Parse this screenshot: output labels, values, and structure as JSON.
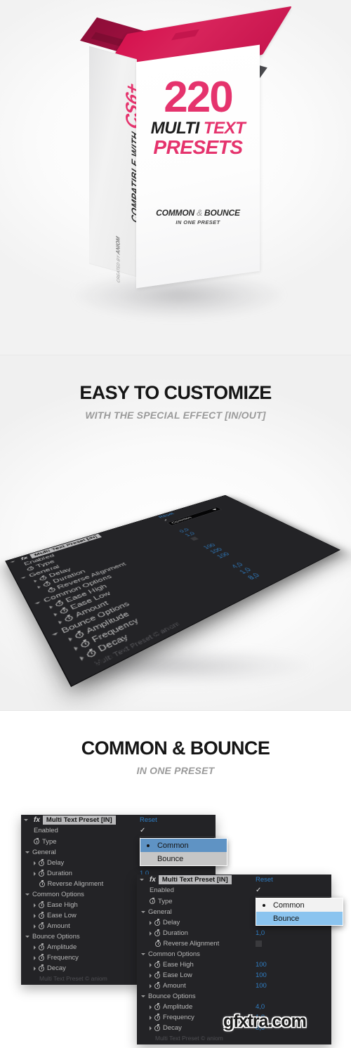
{
  "hero": {
    "spine_prefix": "COMPATIBLE WITH",
    "spine_version": "CS6+",
    "credit_prefix": "CREATED BY",
    "credit_name": "ANIOM",
    "count": "220",
    "multi": "MULTI",
    "text": "TEXT",
    "presets": "PRESETS",
    "common": "COMMON",
    "amp": "&",
    "bounce": "BOUNCE",
    "in_one_preset": "IN ONE PRESET"
  },
  "section_easy": {
    "heading": "EASY TO CUSTOMIZE",
    "subheading": "WITH THE SPECIAL EFFECT [IN/OUT]"
  },
  "section_common_bounce": {
    "heading": "COMMON & BOUNCE",
    "subheading": "IN ONE PRESET"
  },
  "effect_panel": {
    "title": "Multi Text Preset [IN]",
    "fx_label": "fx",
    "reset_label": "Reset",
    "enabled_label": "Enabled",
    "enabled_checked": "✓",
    "type_label": "Type",
    "type_value": "Common",
    "dropdown_options": [
      "Common",
      "Bounce"
    ],
    "groups": [
      {
        "label": "General",
        "rows": [
          {
            "label": "Delay",
            "value": "0,0",
            "twirl": true
          },
          {
            "label": "Duration",
            "value": "1,0",
            "twirl": true
          },
          {
            "label": "Reverse Alignment",
            "value": "",
            "twirl": false,
            "swatch": true
          }
        ]
      },
      {
        "label": "Common Options",
        "rows": [
          {
            "label": "Ease High",
            "value": "100",
            "twirl": true
          },
          {
            "label": "Ease Low",
            "value": "100",
            "twirl": true
          },
          {
            "label": "Amount",
            "value": "100",
            "twirl": true
          }
        ]
      },
      {
        "label": "Bounce Options",
        "rows": [
          {
            "label": "Amplitude",
            "value": "4,0",
            "twirl": true
          },
          {
            "label": "Frequency",
            "value": "1,0",
            "twirl": true
          },
          {
            "label": "Decay",
            "value": "8,0",
            "twirl": true
          }
        ]
      }
    ],
    "footer": "Multi Text Preset © aniom"
  },
  "watermark": "gfxtra.com",
  "colors": {
    "accent_pink": "#e5336d",
    "lid_crimson": "#d6134f",
    "panel_bg": "#232326",
    "value_blue": "#2f7ec4",
    "menu_select_blue": "#5f93c4",
    "menu_hover_blue": "#8bc4ef"
  }
}
